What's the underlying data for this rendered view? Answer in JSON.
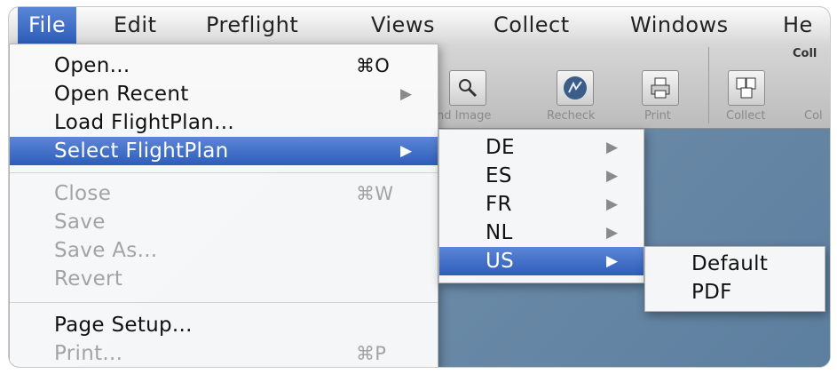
{
  "menubar": {
    "items": [
      "File",
      "Edit",
      "Preflight",
      "Views",
      "Collect",
      "Windows",
      "He"
    ]
  },
  "toolbar": {
    "group_title": "Coll",
    "labels": [
      "nd Image",
      "Recheck",
      "Print",
      "Collect",
      "Col"
    ]
  },
  "file_menu": {
    "items": [
      {
        "label": "Open...",
        "shortcut": "⌘O"
      },
      {
        "label": "Open Recent",
        "arrow": "▶"
      },
      {
        "label": "Load FlightPlan..."
      },
      {
        "label": "Select FlightPlan",
        "arrow": "▶"
      },
      {
        "label": "Close",
        "shortcut": "⌘W"
      },
      {
        "label": "Save"
      },
      {
        "label": "Save As..."
      },
      {
        "label": "Revert"
      },
      {
        "label": "Page Setup..."
      },
      {
        "label": "Print...",
        "shortcut": "⌘P"
      }
    ]
  },
  "flightplan_submenu": {
    "items": [
      {
        "label": "DE",
        "arrow": "▶"
      },
      {
        "label": "ES",
        "arrow": "▶"
      },
      {
        "label": "FR",
        "arrow": "▶"
      },
      {
        "label": "NL",
        "arrow": "▶"
      },
      {
        "label": "US",
        "arrow": "▶"
      }
    ]
  },
  "us_submenu": {
    "items": [
      {
        "label": "Default"
      },
      {
        "label": "PDF"
      }
    ]
  },
  "colors": {
    "highlight": "#2e5dba",
    "disabled_text": "#a3a3a3"
  }
}
